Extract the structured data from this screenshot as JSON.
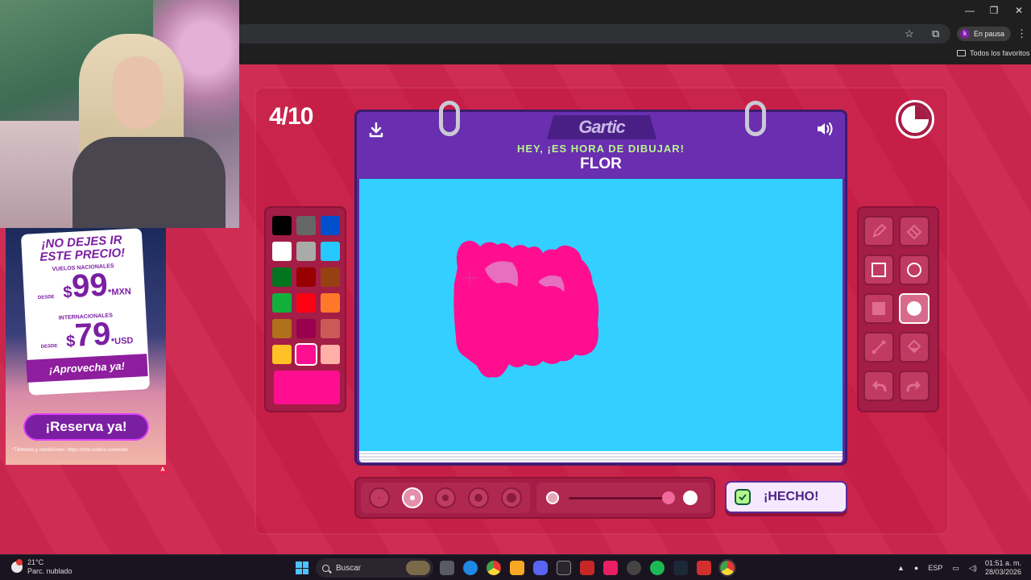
{
  "browser": {
    "window_controls": {
      "minimize": "—",
      "maximize": "❐",
      "close": "✕"
    },
    "profile": {
      "initial": "k",
      "status": "En pausa"
    },
    "bookmarks_folder": "Todos los favoritos"
  },
  "ad": {
    "headline_1": "¡NO DEJES IR",
    "headline_2": "ESTE PRECIO!",
    "national_label": "VUELOS NACIONALES",
    "desde": "DESDE",
    "national_currency": "$",
    "national_price": "99",
    "national_asterisk": "*",
    "national_unit": "MXN",
    "international_label": "INTERNACIONALES",
    "international_currency": "$",
    "international_price": "79",
    "international_asterisk": "*",
    "international_unit": "USD",
    "banner": "¡Aprovecha ya!",
    "cta": "¡Reserva ya!",
    "terms": "*Términos y condiciones: https://cms.volaris.com/es/tc",
    "badge": "A"
  },
  "game": {
    "round": "4/10",
    "logo": "Gartic",
    "prompt": "HEY, ¡ES HORA DE DIBUJAR!",
    "word": "FLOR",
    "done_label": "¡HECHO!",
    "current_color": "#ff0f8f",
    "canvas_color": "#33cfff",
    "timer_remaining": 0.75,
    "palette": [
      "#000000",
      "#666666",
      "#0050cd",
      "#ffffff",
      "#aaaaaa",
      "#26c9ff",
      "#017420",
      "#990000",
      "#964112",
      "#11b03c",
      "#ff0013",
      "#ff7829",
      "#b0701c",
      "#99004e",
      "#cb5a57",
      "#ffc126",
      "#ff0f8f",
      "#feafa8"
    ],
    "selected_color_index": 16,
    "tools": [
      "pencil-icon",
      "eraser-icon",
      "rectangle-outline-icon",
      "circle-outline-icon",
      "rectangle-filled-icon",
      "circle-filled-icon",
      "line-icon",
      "fill-bucket-icon",
      "undo-icon",
      "redo-icon"
    ],
    "selected_tool_index": 5,
    "brush_sizes": 5,
    "selected_size_index": 1,
    "opacity": 0.95
  },
  "taskbar": {
    "temperature": "21°C",
    "weather": "Parc. nublado",
    "search_placeholder": "Buscar",
    "language": "ESP",
    "time": "01:51 a. m.",
    "date": "28/03/2026"
  }
}
